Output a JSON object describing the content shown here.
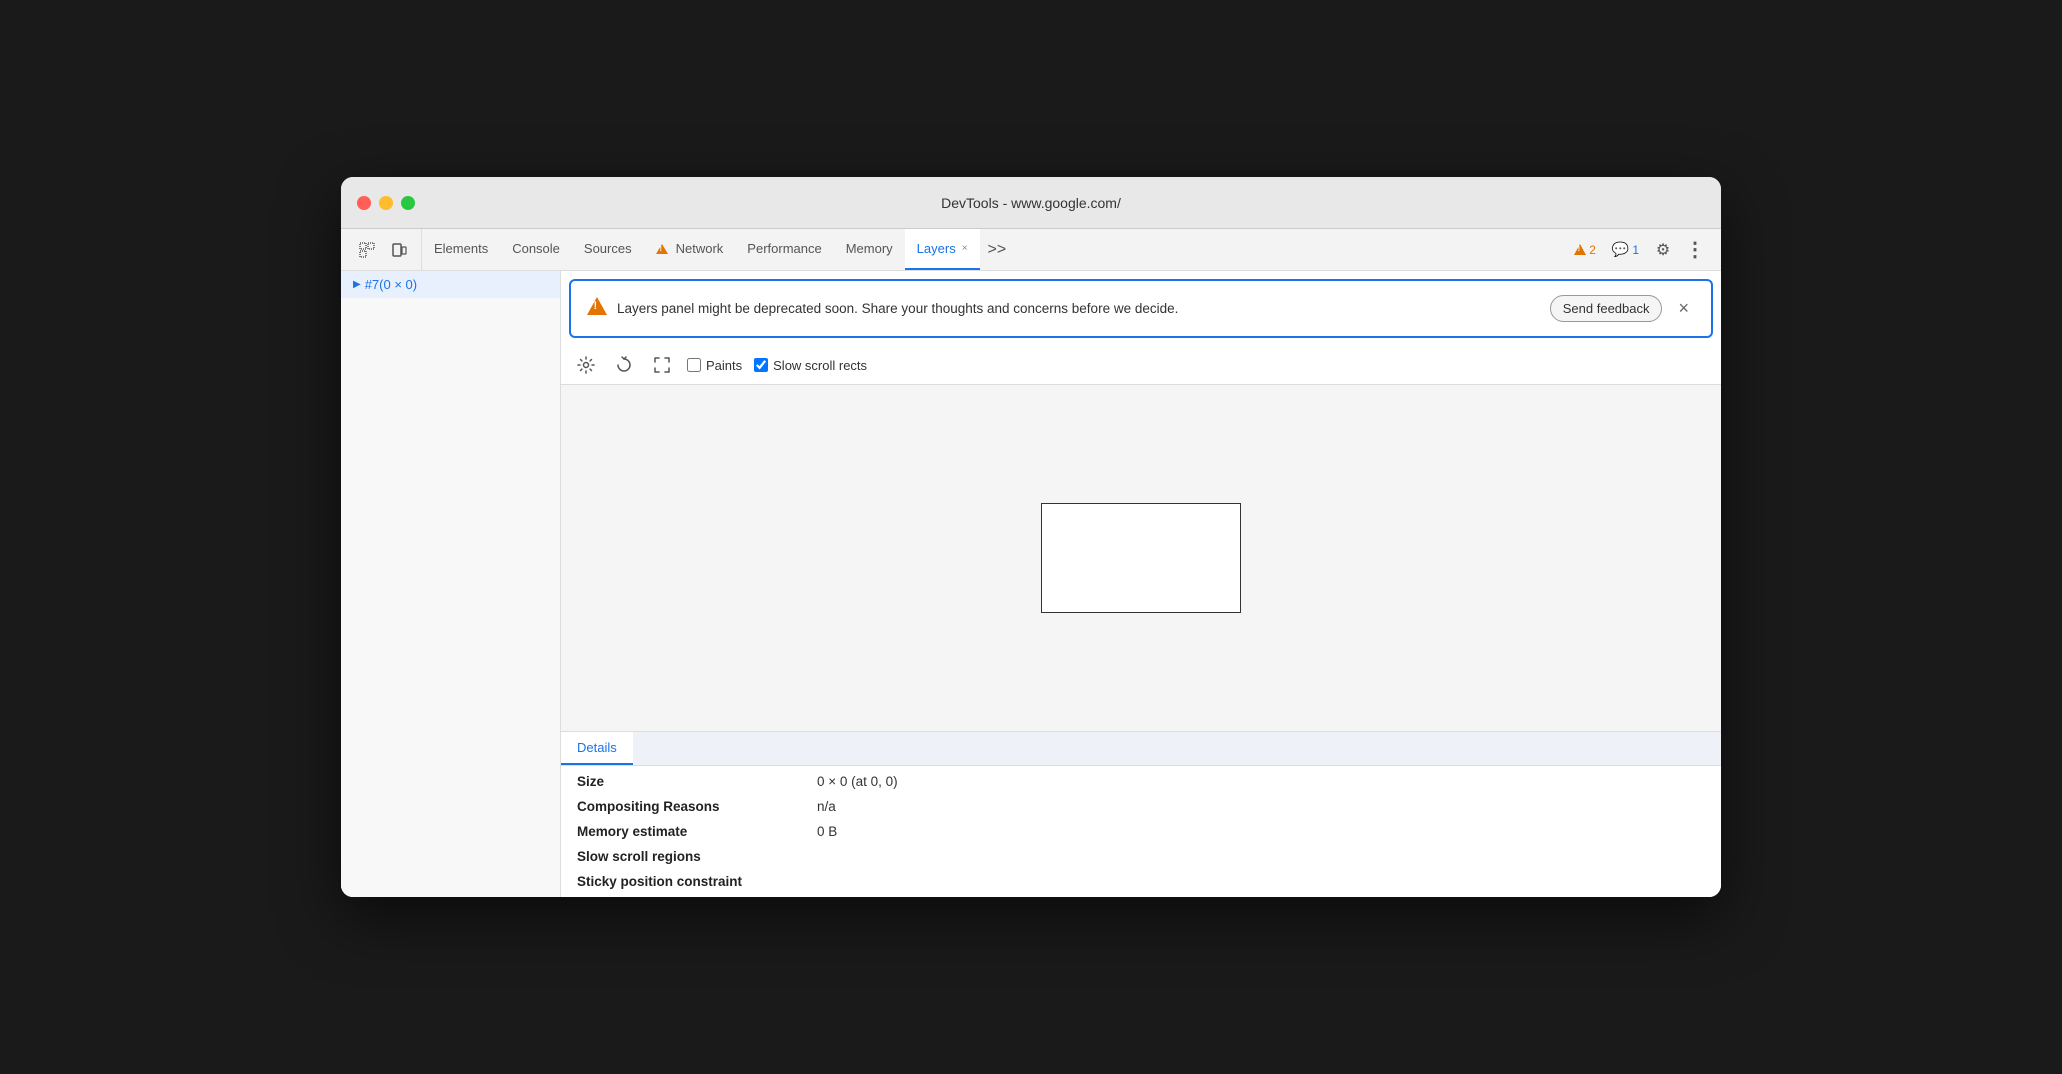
{
  "window": {
    "title": "DevTools - www.google.com/"
  },
  "tabs": {
    "items": [
      {
        "id": "elements",
        "label": "Elements",
        "active": false,
        "has_warning": false
      },
      {
        "id": "console",
        "label": "Console",
        "active": false,
        "has_warning": false
      },
      {
        "id": "sources",
        "label": "Sources",
        "active": false,
        "has_warning": false
      },
      {
        "id": "network",
        "label": "Network",
        "active": false,
        "has_warning": true
      },
      {
        "id": "performance",
        "label": "Performance",
        "active": false,
        "has_warning": false
      },
      {
        "id": "memory",
        "label": "Memory",
        "active": false,
        "has_warning": false
      },
      {
        "id": "layers",
        "label": "Layers",
        "active": true,
        "has_warning": false
      }
    ],
    "more_label": ">>",
    "warnings_count": "2",
    "info_count": "1"
  },
  "sidebar": {
    "items": [
      {
        "id": "node1",
        "label": "#7(0 × 0)",
        "active": true
      }
    ]
  },
  "warning_banner": {
    "message": "Layers panel might be deprecated soon. Share your thoughts and concerns before we decide.",
    "send_feedback_label": "Send feedback",
    "close_label": "×"
  },
  "toolbar": {
    "paints_label": "Paints",
    "slow_scroll_rects_label": "Slow scroll rects",
    "paints_checked": false,
    "slow_scroll_rects_checked": true
  },
  "details": {
    "tab_label": "Details",
    "rows": [
      {
        "label": "Size",
        "value": "0 × 0 (at 0, 0)"
      },
      {
        "label": "Compositing Reasons",
        "value": "n/a"
      },
      {
        "label": "Memory estimate",
        "value": "0 B"
      },
      {
        "label": "Slow scroll regions",
        "value": ""
      },
      {
        "label": "Sticky position constraint",
        "value": ""
      }
    ]
  },
  "colors": {
    "active_tab": "#1a73e8",
    "warning": "#e37400",
    "banner_border": "#1a73e8"
  }
}
